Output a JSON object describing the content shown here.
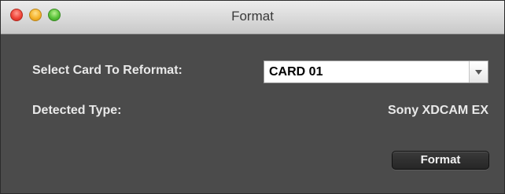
{
  "window": {
    "title": "Format",
    "controls": {
      "close": "close-button",
      "minimize": "minimize-button",
      "zoom": "zoom-button"
    }
  },
  "form": {
    "select_card_label": "Select Card To Reformat:",
    "card_select_value": "CARD 01",
    "detected_type_label": "Detected Type:",
    "detected_type_value": "Sony XDCAM EX",
    "format_button_label": "Format"
  },
  "colors": {
    "close": "#f0453a",
    "minimize": "#f5b42d",
    "zoom": "#59c23a",
    "panel_background": "#4b4b4b"
  }
}
